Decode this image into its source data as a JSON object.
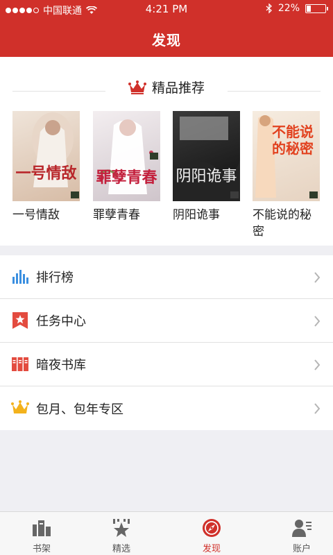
{
  "status_bar": {
    "carrier": "中国联通",
    "time": "4:21 PM",
    "battery": "22%",
    "battery_level": 0.22
  },
  "header": {
    "title": "发现"
  },
  "recommend": {
    "title": "精品推荐",
    "books": [
      {
        "title": "一号情敌",
        "cover_text": "一号情敌",
        "cover_colors": [
          "#efe4d9",
          "#d7bca6"
        ]
      },
      {
        "title": "罪孽青春",
        "cover_text": "罪孽青春",
        "cover_colors": [
          "#f3eef0",
          "#cfc5cb"
        ]
      },
      {
        "title": "阴阳诡事",
        "cover_text": "阴阳诡事",
        "cover_colors": [
          "#3a3a3a",
          "#0f0f0f"
        ]
      },
      {
        "title": "不能说的秘密",
        "cover_text": "不能说的秘密",
        "cover_colors": [
          "#f6ece0",
          "#e6d3c1"
        ]
      }
    ]
  },
  "menu": [
    {
      "label": "排行榜",
      "icon": "bar-chart-icon"
    },
    {
      "label": "任务中心",
      "icon": "bookmark-star-icon"
    },
    {
      "label": "暗夜书库",
      "icon": "books-icon"
    },
    {
      "label": "包月、包年专区",
      "icon": "crown-icon"
    }
  ],
  "tabs": [
    {
      "label": "书架",
      "icon": "bookshelf-icon",
      "active": false
    },
    {
      "label": "精选",
      "icon": "star-icon",
      "active": false
    },
    {
      "label": "发现",
      "icon": "compass-icon",
      "active": true
    },
    {
      "label": "账户",
      "icon": "user-icon",
      "active": false
    }
  ],
  "colors": {
    "brand_red": "#d0302a",
    "blue": "#3b8fe0",
    "gold": "#f3b21c",
    "red_icon": "#e34b3f"
  }
}
